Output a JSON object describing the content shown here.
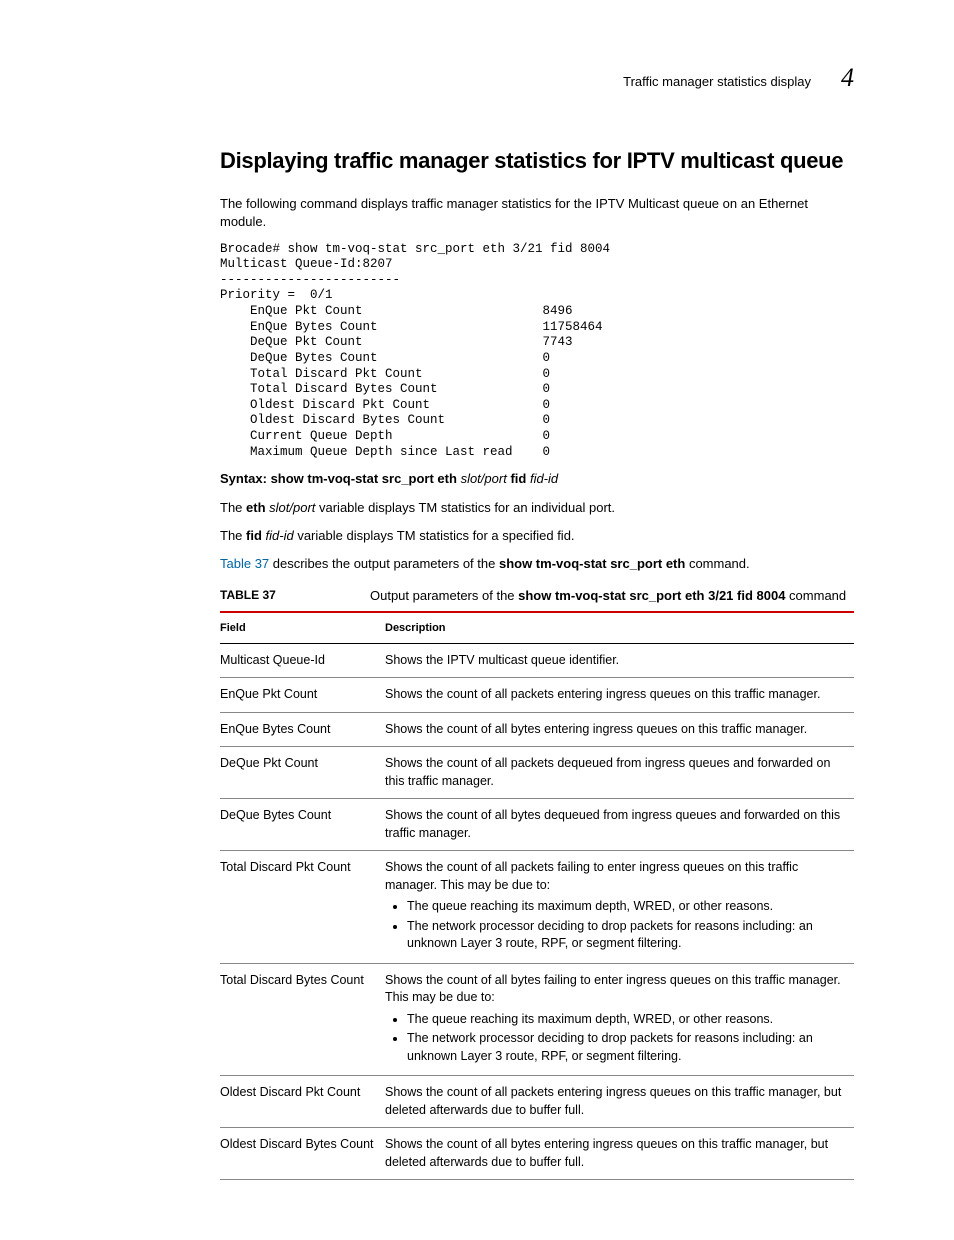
{
  "header": {
    "text": "Traffic manager statistics display",
    "num": "4"
  },
  "title": "Displaying traffic manager statistics for IPTV multicast queue",
  "intro": "The following command displays traffic manager statistics for the IPTV Multicast queue on an Ethernet module.",
  "cli": "Brocade# show tm-voq-stat src_port eth 3/21 fid 8004\nMulticast Queue-Id:8207\n------------------------\nPriority =  0/1\n    EnQue Pkt Count                        8496\n    EnQue Bytes Count                      11758464\n    DeQue Pkt Count                        7743\n    DeQue Bytes Count                      0\n    Total Discard Pkt Count                0\n    Total Discard Bytes Count              0\n    Oldest Discard Pkt Count               0\n    Oldest Discard Bytes Count             0\n    Current Queue Depth                    0\n    Maximum Queue Depth since Last read    0",
  "syntax": {
    "prefix": "Syntax:  show tm-voq-stat src_port eth",
    "arg1": "slot/port",
    "mid": "fid",
    "arg2": "fid-id"
  },
  "p1a": "The ",
  "p1b": "eth",
  "p1c": " ",
  "p1d": "slot/port",
  "p1e": " variable displays TM statistics for an individual port.",
  "p2a": "The ",
  "p2b": "fid",
  "p2c": " ",
  "p2d": "fid-id",
  "p2e": " variable displays TM statistics for a specified fid.",
  "p3a": "Table 37",
  "p3b": " describes the output parameters of the ",
  "p3c": "show tm-voq-stat src_port eth",
  "p3d": " command.",
  "caption": {
    "label": "TABLE 37",
    "textA": "Output parameters of the ",
    "textB": "show tm-voq-stat src_port eth 3/21 fid 8004",
    "textC": " command"
  },
  "th1": "Field",
  "th2": "Description",
  "rows": [
    {
      "f": "Multicast Queue-Id",
      "d": "Shows the IPTV multicast queue identifier."
    },
    {
      "f": "EnQue Pkt Count",
      "d": "Shows the count of all packets entering ingress queues on this traffic manager."
    },
    {
      "f": "EnQue Bytes Count",
      "d": "Shows the count of all bytes entering ingress queues on this traffic manager."
    },
    {
      "f": "DeQue Pkt Count",
      "d": "Shows the count of all packets dequeued from ingress queues and forwarded on this traffic manager."
    },
    {
      "f": "DeQue Bytes Count",
      "d": "Shows the count of all bytes dequeued from ingress queues and forwarded on this traffic manager."
    },
    {
      "f": "Total Discard Pkt Count",
      "d_intro": "Shows the count of all packets failing to enter ingress queues on this traffic manager. This may be due to:",
      "b1": "The queue reaching its maximum depth, WRED, or other reasons.",
      "b2": "The network processor deciding to drop packets for reasons including: an unknown Layer 3 route, RPF, or segment filtering."
    },
    {
      "f": "Total Discard Bytes Count",
      "d_intro": "Shows the count of all bytes failing to enter ingress queues on this traffic manager. This may be due to:",
      "b1": "The queue reaching its maximum depth, WRED, or other reasons.",
      "b2": "The network processor deciding to drop packets for reasons including: an unknown Layer 3 route, RPF, or segment filtering."
    },
    {
      "f": "Oldest Discard Pkt Count",
      "d": "Shows the count of all packets entering ingress queues on this traffic manager, but deleted afterwards due to buffer full."
    },
    {
      "f": "Oldest Discard Bytes Count",
      "d": "Shows the count of all bytes entering ingress queues on this traffic manager, but deleted afterwards due to buffer full."
    }
  ]
}
